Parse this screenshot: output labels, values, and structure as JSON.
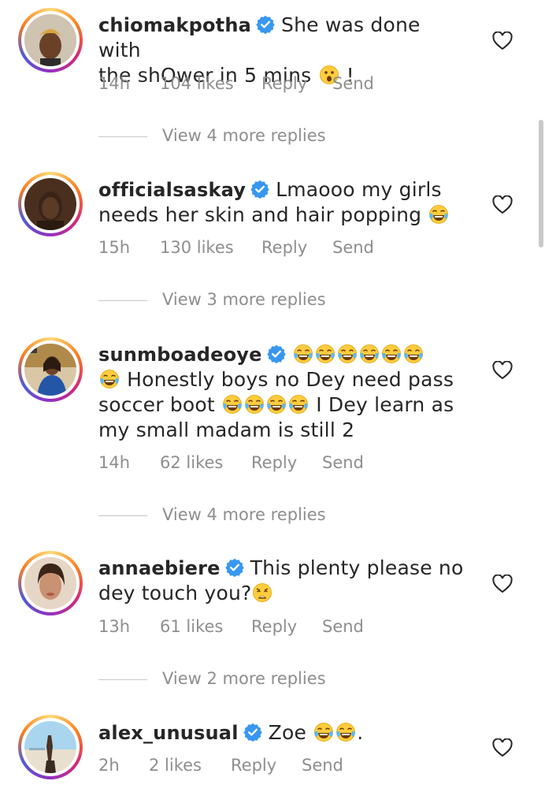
{
  "comments": [
    {
      "username": "chiomakpotha",
      "text_line1": "She was done with",
      "text_line2": "the shOwer in 5 mins",
      "text_line2_suffix": " !",
      "time": "14h",
      "likes": "104 likes",
      "reply": "Reply",
      "send": "Send",
      "view_replies": "View 4 more replies",
      "emoji": "astonished"
    },
    {
      "username": "officialsaskay",
      "text_line1": "Lmaooo my girls",
      "text_line2": "needs her skin and hair popping",
      "time": "15h",
      "likes": "130 likes",
      "reply": "Reply",
      "send": "Send",
      "view_replies": "View 3 more replies",
      "emoji": "tears-of-joy"
    },
    {
      "username": "sunmboadeoye",
      "text_line2": "Honestly boys no Dey need pass",
      "text_line3a": "soccer boot",
      "text_line3b": "I Dey learn as",
      "text_line4": "my small madam is still 2",
      "time": "14h",
      "likes": "62 likes",
      "reply": "Reply",
      "send": "Send",
      "view_replies": "View 4 more replies",
      "emoji": "tears-of-joy"
    },
    {
      "username": "annaebiere",
      "text_line1": "This plenty please no",
      "text_line2": "dey touch you?",
      "time": "13h",
      "likes": "61 likes",
      "reply": "Reply",
      "send": "Send",
      "view_replies": "View 2 more replies",
      "emoji": "weary"
    },
    {
      "username": "alex_unusual",
      "text_line1": "Zoe",
      "text_line1_suffix": ".",
      "time": "2h",
      "likes": "2 likes",
      "reply": "Reply",
      "send": "Send",
      "emoji": "tears-of-joy"
    }
  ],
  "colors": {
    "text": "#262626",
    "meta": "#8e8e8e",
    "verified": "#3897f0",
    "divider": "#c7c7c7"
  }
}
